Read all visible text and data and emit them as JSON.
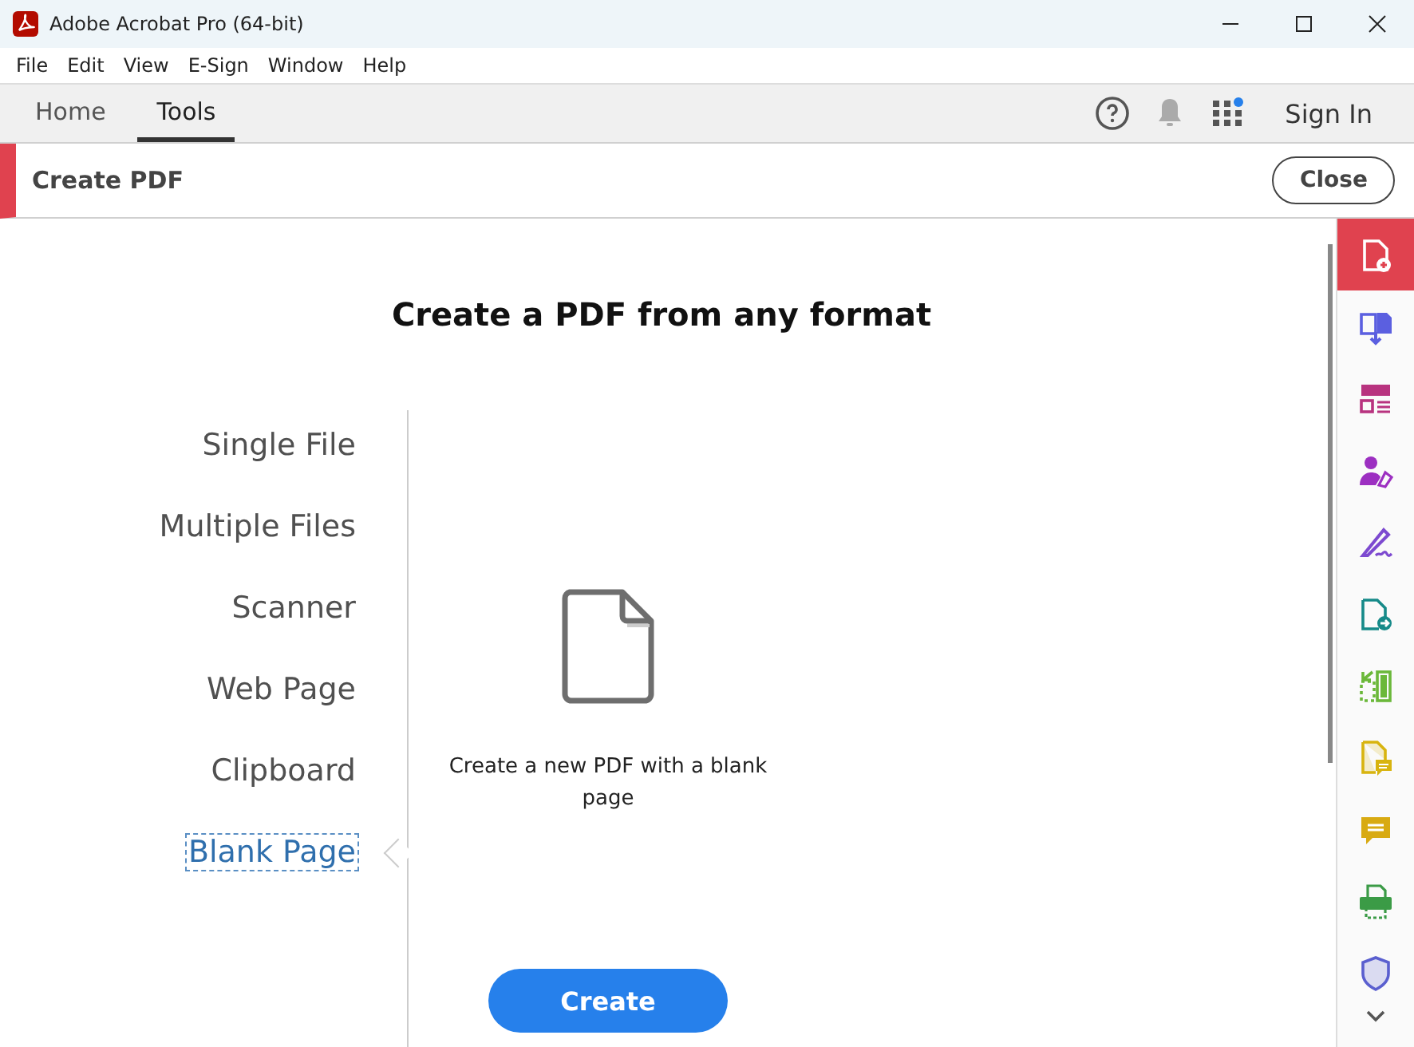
{
  "window": {
    "title": "Adobe Acrobat Pro (64-bit)"
  },
  "menu": [
    "File",
    "Edit",
    "View",
    "E-Sign",
    "Window",
    "Help"
  ],
  "tabs": [
    {
      "label": "Home",
      "selected": false
    },
    {
      "label": "Tools",
      "selected": true
    }
  ],
  "apps_badge": true,
  "sign_in": "Sign In",
  "tool_header": {
    "title": "Create PDF",
    "close": "Close"
  },
  "heading": "Create a PDF from any format",
  "sources": [
    {
      "label": "Single File",
      "selected": false
    },
    {
      "label": "Multiple Files",
      "selected": false
    },
    {
      "label": "Scanner",
      "selected": false
    },
    {
      "label": "Web Page",
      "selected": false
    },
    {
      "label": "Clipboard",
      "selected": false
    },
    {
      "label": "Blank Page",
      "selected": true
    }
  ],
  "description": "Create a new PDF with a blank page",
  "create_button": "Create",
  "tools": [
    {
      "kind": "create",
      "color": "#ffffff",
      "selected": true
    },
    {
      "kind": "export",
      "color": "#5b5fe0",
      "selected": false
    },
    {
      "kind": "organize",
      "color": "#b8337f",
      "selected": false
    },
    {
      "kind": "request",
      "color": "#9c2fc1",
      "selected": false
    },
    {
      "kind": "sign",
      "color": "#7d4ad0",
      "selected": false
    },
    {
      "kind": "send",
      "color": "#168a89",
      "selected": false
    },
    {
      "kind": "compare",
      "color": "#6bb83a",
      "selected": false
    },
    {
      "kind": "review",
      "color": "#d8b40f",
      "selected": false
    },
    {
      "kind": "comment",
      "color": "#d8aa12",
      "selected": false
    },
    {
      "kind": "print",
      "color": "#3b9b46",
      "selected": false
    },
    {
      "kind": "protect",
      "color": "#5a5fcf",
      "selected": false
    }
  ]
}
